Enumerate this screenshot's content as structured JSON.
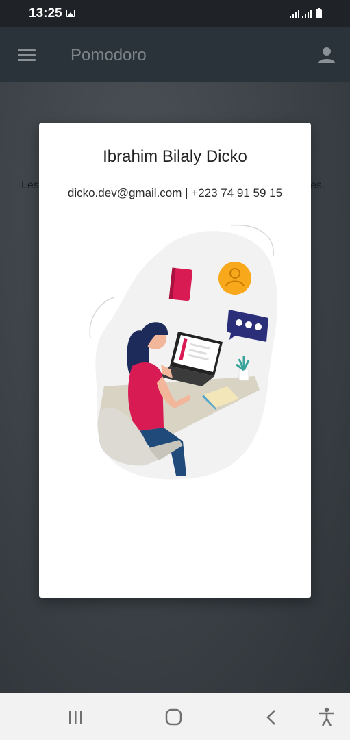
{
  "status_bar": {
    "time": "13:25",
    "icons": [
      "image-icon",
      "signal-icon",
      "signal-icon",
      "battery-icon"
    ]
  },
  "app_bar": {
    "title": "Pomodoro",
    "menu_icon": "menu-icon",
    "user_icon": "user-icon"
  },
  "background": {
    "text_left": "Les",
    "text_right": "es."
  },
  "dialog": {
    "name": "Ibrahim Bilaly Dicko",
    "contact": "dicko.dev@gmail.com | +223 74 91 59 15",
    "illustration": "developer-at-laptop-illustration"
  },
  "nav_bar": {
    "buttons": [
      "recents-icon",
      "home-icon",
      "back-icon",
      "accessibility-icon"
    ]
  },
  "colors": {
    "app_bar": "#2a3339",
    "status_bar": "#1f2327",
    "dialog": "#ffffff",
    "accent_pink": "#d81b52",
    "accent_yellow": "#f7a81b",
    "accent_navy": "#2b2f7a"
  }
}
